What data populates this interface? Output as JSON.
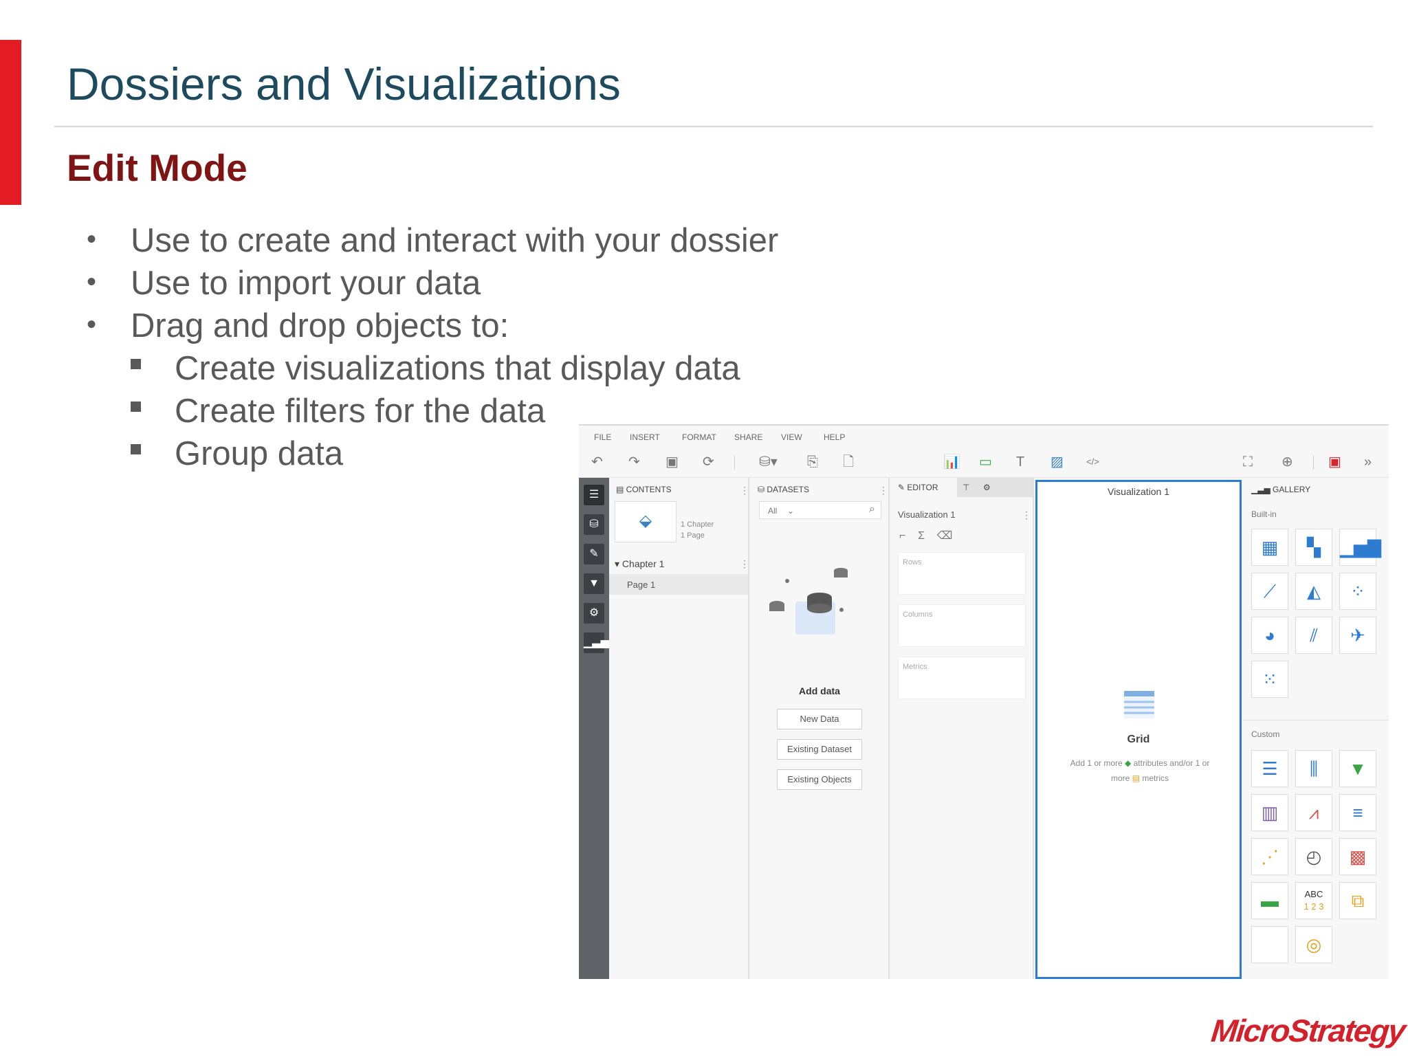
{
  "slide": {
    "title": "Dossiers and Visualizations",
    "subtitle": "Edit Mode",
    "bullets": [
      "Use to create and interact with your dossier",
      "Use to import your data",
      "Drag and drop objects to:"
    ],
    "sub_bullets": [
      "Create visualizations that display data",
      "Create filters for the data",
      "Group data"
    ],
    "logo": "MicroStrategy"
  },
  "app": {
    "menu": [
      "FILE",
      "INSERT",
      "FORMAT",
      "SHARE",
      "VIEW",
      "HELP"
    ],
    "contents": {
      "title": "CONTENTS",
      "thumb_info_1": "1 Chapter",
      "thumb_info_2": "1 Page",
      "chapter": "Chapter 1",
      "page": "Page 1"
    },
    "datasets": {
      "title": "DATASETS",
      "filter_value": "All",
      "add_title": "Add data",
      "buttons": [
        "New Data",
        "Existing Dataset",
        "Existing Objects"
      ]
    },
    "editor": {
      "tab_label": "EDITOR",
      "viz_name": "Visualization 1",
      "zones": [
        "Rows",
        "Columns",
        "Metrics"
      ]
    },
    "visualization": {
      "title": "Visualization 1",
      "type_label": "Grid",
      "hint_1": "Add 1 or more",
      "hint_2": "attributes and/or 1 or",
      "hint_3": "more",
      "hint_4": "metrics"
    },
    "gallery": {
      "title": "GALLERY",
      "builtin_label": "Built-in",
      "custom_label": "Custom",
      "custom_abc": "ABC",
      "custom_123": "1 2 3"
    },
    "colors": {
      "accent": "#2e7cd1",
      "sidebar": "#5f6368",
      "brand_red": "#e31b23"
    }
  }
}
